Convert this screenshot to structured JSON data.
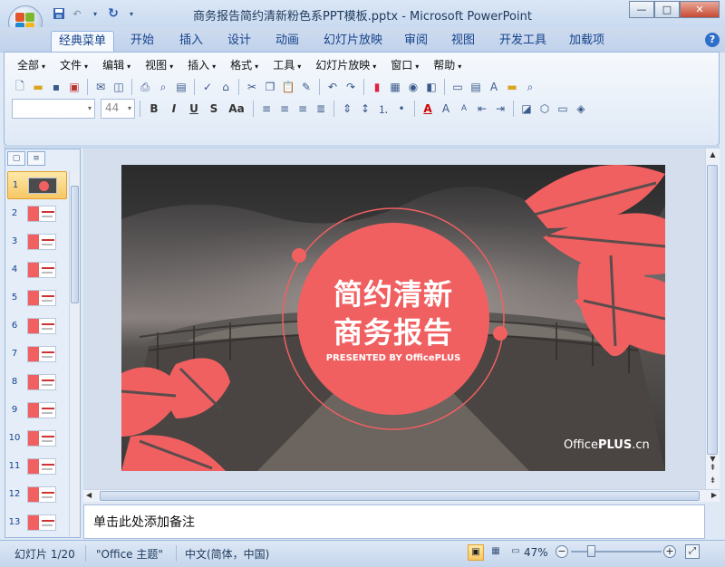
{
  "window": {
    "title": "商务报告简约清新粉色系PPT模板.pptx - Microsoft PowerPoint",
    "min_glyph": "—",
    "max_glyph": "□",
    "close_glyph": "✕"
  },
  "quick_access": [
    {
      "name": "save-icon",
      "glyph": "■"
    },
    {
      "name": "undo-icon",
      "glyph": "↶"
    },
    {
      "name": "undo-dropdown-icon",
      "glyph": "▾"
    },
    {
      "name": "redo-icon",
      "glyph": "↻"
    },
    {
      "name": "customize-qat-icon",
      "glyph": "▾"
    }
  ],
  "tabs": [
    {
      "label": "经典菜单",
      "active": true
    },
    {
      "label": "开始"
    },
    {
      "label": "插入"
    },
    {
      "label": "设计"
    },
    {
      "label": "动画"
    },
    {
      "label": "幻灯片放映"
    },
    {
      "label": "审阅"
    },
    {
      "label": "视图"
    },
    {
      "label": "开发工具"
    },
    {
      "label": "加载项"
    }
  ],
  "help_glyph": "?",
  "menus": [
    "全部",
    "文件",
    "编辑",
    "视图",
    "插入",
    "格式",
    "工具",
    "幻灯片放映",
    "窗口",
    "帮助"
  ],
  "font": {
    "name": "",
    "size": "44"
  },
  "format_buttons": [
    "B",
    "I",
    "U",
    "S",
    "Aa"
  ],
  "left_pane": {
    "tab_outline_glyph": "≡",
    "thumbnails": [
      "1",
      "2",
      "3",
      "4",
      "5",
      "6",
      "7",
      "8",
      "9",
      "10",
      "11",
      "12",
      "13"
    ],
    "selected": 1
  },
  "slide": {
    "title_line1": "简约清新",
    "title_line2": "商务报告",
    "presented_prefix": "PRESENTED BY ",
    "presented_brand": "OfficePLUS",
    "footer_brand_a": "Office",
    "footer_brand_b": "PLUS",
    "footer_brand_c": ".cn",
    "accent": "#f16061"
  },
  "notes_placeholder": "单击此处添加备注",
  "status": {
    "slide_info": "幻灯片 1/20",
    "theme": "\"Office 主题\"",
    "language": "中文(简体，中国)",
    "zoom": "47%"
  }
}
